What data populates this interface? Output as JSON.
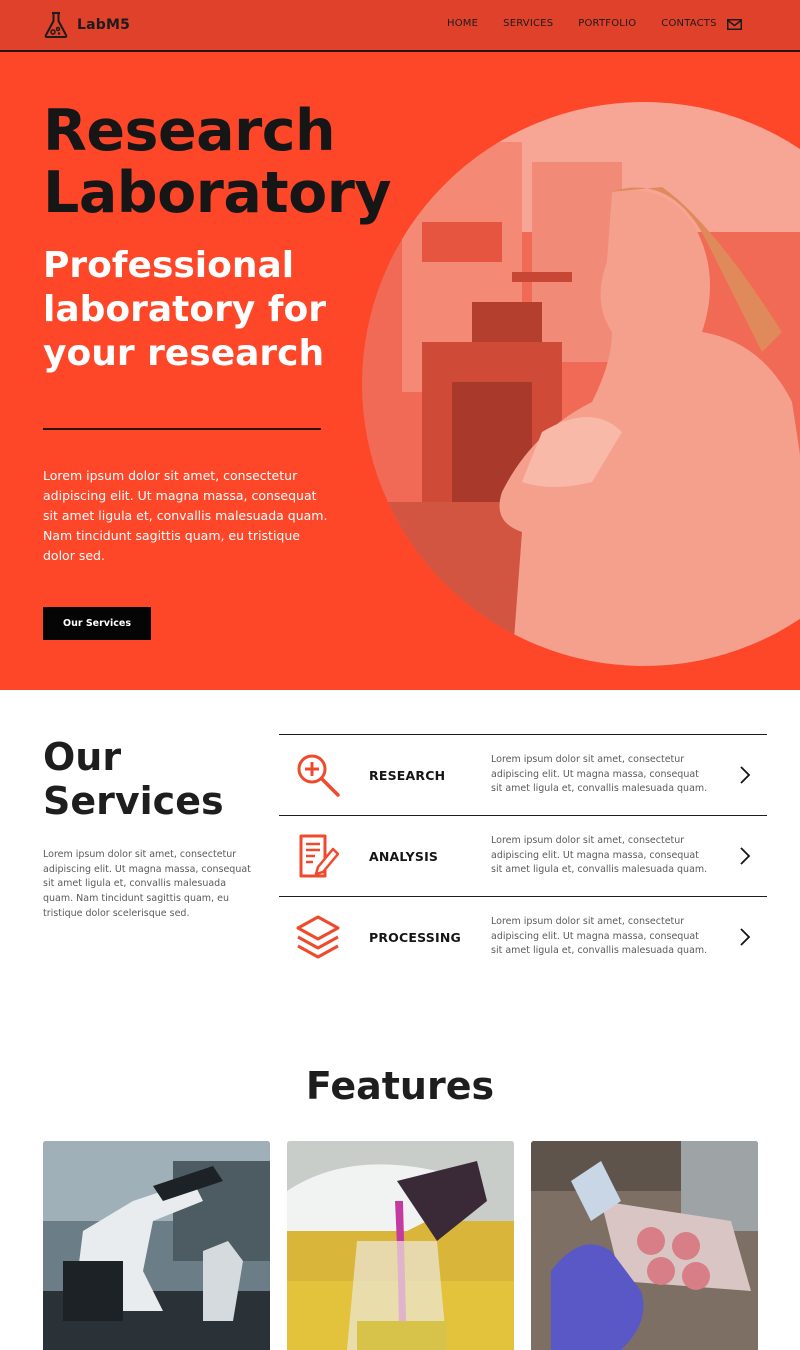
{
  "brand": {
    "name": "LabM5",
    "accent": "#fd4728",
    "nav_bg": "#e0412b",
    "logo_icon": "flask-icon"
  },
  "nav": {
    "items": [
      "HOME",
      "SERVICES",
      "PORTFOLIO",
      "CONTACTS"
    ],
    "mail_icon": "mail-icon"
  },
  "hero": {
    "title_line1": "Research",
    "title_line2": "Laboratory",
    "subtitle": "Professional laboratory for your research",
    "body": "Lorem ipsum dolor sit amet, consectetur adipiscing elit. Ut magna massa, consequat sit amet ligula et, convallis malesuada quam. Nam tincidunt sagittis quam, eu tristique dolor sed.",
    "button": "Our Services"
  },
  "services": {
    "title_line1": "Our",
    "title_line2": "Services",
    "body": "Lorem ipsum dolor sit amet, consectetur adipiscing elit. Ut magna massa, consequat sit amet ligula et, convallis malesuada quam. Nam tincidunt sagittis quam, eu tristique dolor scelerisque sed.",
    "items": [
      {
        "name": "RESEARCH",
        "icon": "magnifier-plus-icon",
        "desc": "Lorem ipsum dolor sit amet, consectetur adipiscing elit. Ut magna massa, consequat sit amet ligula et, convallis malesuada quam."
      },
      {
        "name": "ANALYSIS",
        "icon": "document-edit-icon",
        "desc": "Lorem ipsum dolor sit amet, consectetur adipiscing elit. Ut magna massa, consequat sit amet ligula et, convallis malesuada quam."
      },
      {
        "name": "PROCESSING",
        "icon": "layers-icon",
        "desc": "Lorem ipsum dolor sit amet, consectetur adipiscing elit. Ut magna massa, consequat sit amet ligula et, convallis malesuada quam."
      }
    ]
  },
  "features": {
    "title": "Features"
  }
}
